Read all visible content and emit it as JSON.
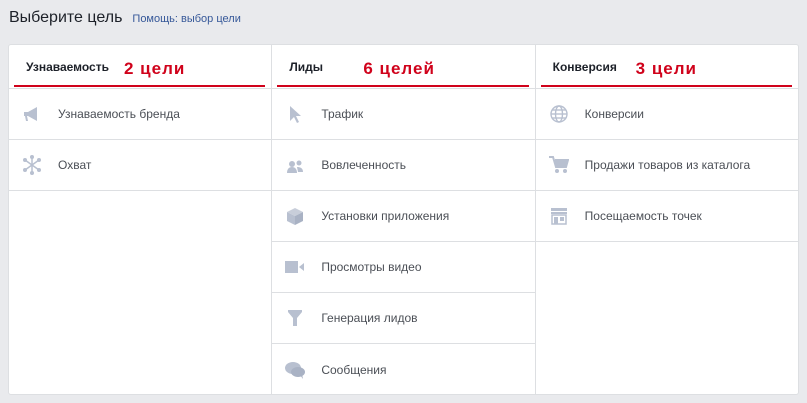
{
  "header": {
    "title": "Выберите цель",
    "help_link": "Помощь: выбор цели"
  },
  "columns": [
    {
      "label": "Узнаваемость",
      "count_annotation": "2 цели",
      "items": [
        {
          "label": "Узнаваемость бренда",
          "icon": "megaphone-icon"
        },
        {
          "label": "Охват",
          "icon": "reach-icon"
        }
      ]
    },
    {
      "label": "Лиды",
      "count_annotation": "6 целей",
      "items": [
        {
          "label": "Трафик",
          "icon": "cursor-icon"
        },
        {
          "label": "Вовлеченность",
          "icon": "people-icon"
        },
        {
          "label": "Установки приложения",
          "icon": "box-icon"
        },
        {
          "label": "Просмотры видео",
          "icon": "video-camera-icon"
        },
        {
          "label": "Генерация лидов",
          "icon": "funnel-icon"
        },
        {
          "label": "Сообщения",
          "icon": "chat-bubbles-icon"
        }
      ]
    },
    {
      "label": "Конверсия",
      "count_annotation": "3 цели",
      "items": [
        {
          "label": "Конверсии",
          "icon": "globe-icon"
        },
        {
          "label": "Продажи товаров из каталога",
          "icon": "cart-icon"
        },
        {
          "label": "Посещаемость точек",
          "icon": "store-icon"
        }
      ]
    }
  ],
  "colors": {
    "annotation": "#d0021b",
    "icon": "#b8c0d0",
    "link": "#365899"
  }
}
